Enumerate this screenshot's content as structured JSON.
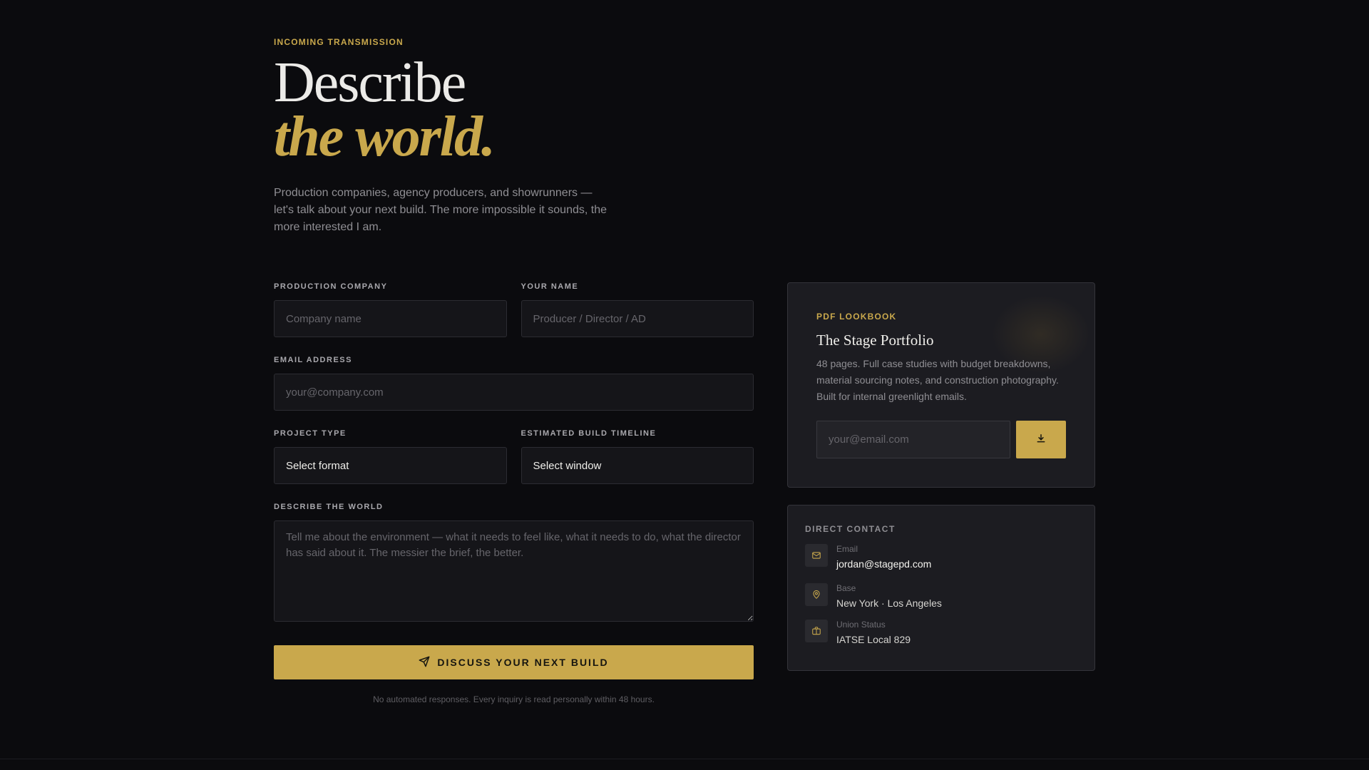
{
  "hero": {
    "eyebrow": "INCOMING TRANSMISSION",
    "title_line1": "Describe",
    "title_line2": "the world.",
    "intro": "Production companies, agency producers, and showrunners — let's talk about your next build. The more impossible it sounds, the more interested I am."
  },
  "form": {
    "company": {
      "label": "PRODUCTION COMPANY",
      "placeholder": "Company name",
      "value": ""
    },
    "name": {
      "label": "YOUR NAME",
      "placeholder": "Producer / Director / AD",
      "value": ""
    },
    "email": {
      "label": "EMAIL ADDRESS",
      "placeholder": "your@company.com",
      "value": ""
    },
    "project_type": {
      "label": "PROJECT TYPE",
      "selected": "Select format"
    },
    "timeline": {
      "label": "ESTIMATED BUILD TIMELINE",
      "selected": "Select window"
    },
    "describe": {
      "label": "DESCRIBE THE WORLD",
      "placeholder": "Tell me about the environment — what it needs to feel like, what it needs to do, what the director has said about it. The messier the brief, the better."
    },
    "submit_label": "DISCUSS YOUR NEXT BUILD",
    "note": "No automated responses. Every inquiry is read personally within 48 hours."
  },
  "lookbook": {
    "eyebrow": "PDF LOOKBOOK",
    "title": "The Stage Portfolio",
    "description": "48 pages. Full case studies with budget breakdowns, material sourcing notes, and construction photography. Built for internal greenlight emails.",
    "email_placeholder": "your@email.com",
    "download_icon": "download-icon"
  },
  "contact": {
    "title": "DIRECT CONTACT",
    "items": [
      {
        "icon": "mail-icon",
        "key": "Email",
        "value": "jordan@stagepd.com"
      },
      {
        "icon": "map-pin-icon",
        "key": "Base",
        "value": "New York · Los Angeles"
      },
      {
        "icon": "briefcase-icon",
        "key": "Union Status",
        "value": "IATSE Local 829"
      }
    ]
  },
  "colors": {
    "background": "#0b0b0e",
    "accent": "#c9a84c",
    "card": "#1c1c21",
    "input": "#151519"
  }
}
